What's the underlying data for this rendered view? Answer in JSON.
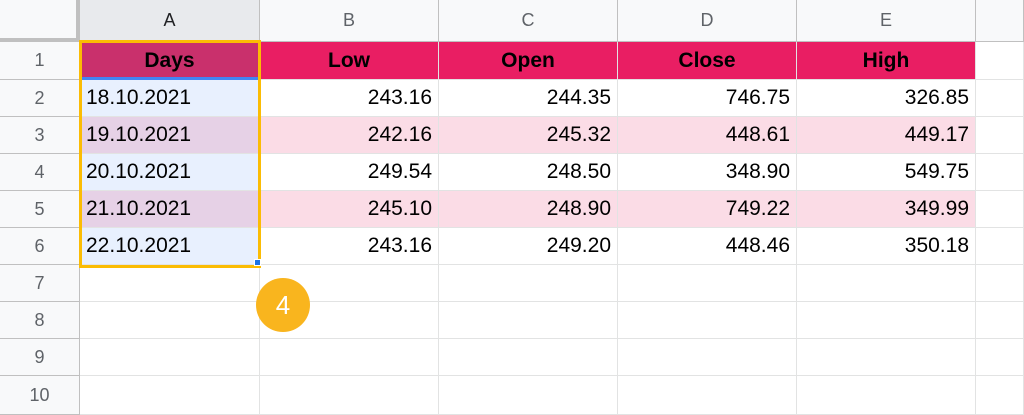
{
  "column_headers": [
    "A",
    "B",
    "C",
    "D",
    "E"
  ],
  "row_headers": [
    "1",
    "2",
    "3",
    "4",
    "5",
    "6",
    "7",
    "8",
    "9",
    "10"
  ],
  "table": {
    "headers": [
      "Days",
      "Low",
      "Open",
      "Close",
      "High"
    ],
    "rows": [
      [
        "18.10.2021",
        "243.16",
        "244.35",
        "746.75",
        "326.85"
      ],
      [
        "19.10.2021",
        "242.16",
        "245.32",
        "448.61",
        "449.17"
      ],
      [
        "20.10.2021",
        "249.54",
        "248.50",
        "348.90",
        "549.75"
      ],
      [
        "21.10.2021",
        "245.10",
        "248.90",
        "749.22",
        "349.99"
      ],
      [
        "22.10.2021",
        "243.16",
        "249.20",
        "448.46",
        "350.18"
      ]
    ]
  },
  "selection": {
    "range": "A1:A6",
    "step_badge": "4"
  },
  "colors": {
    "header_fill": "#e91e63",
    "band_fill": "#fbdce6",
    "selection_border": "#fbbc04",
    "badge": "#f9b51e"
  }
}
